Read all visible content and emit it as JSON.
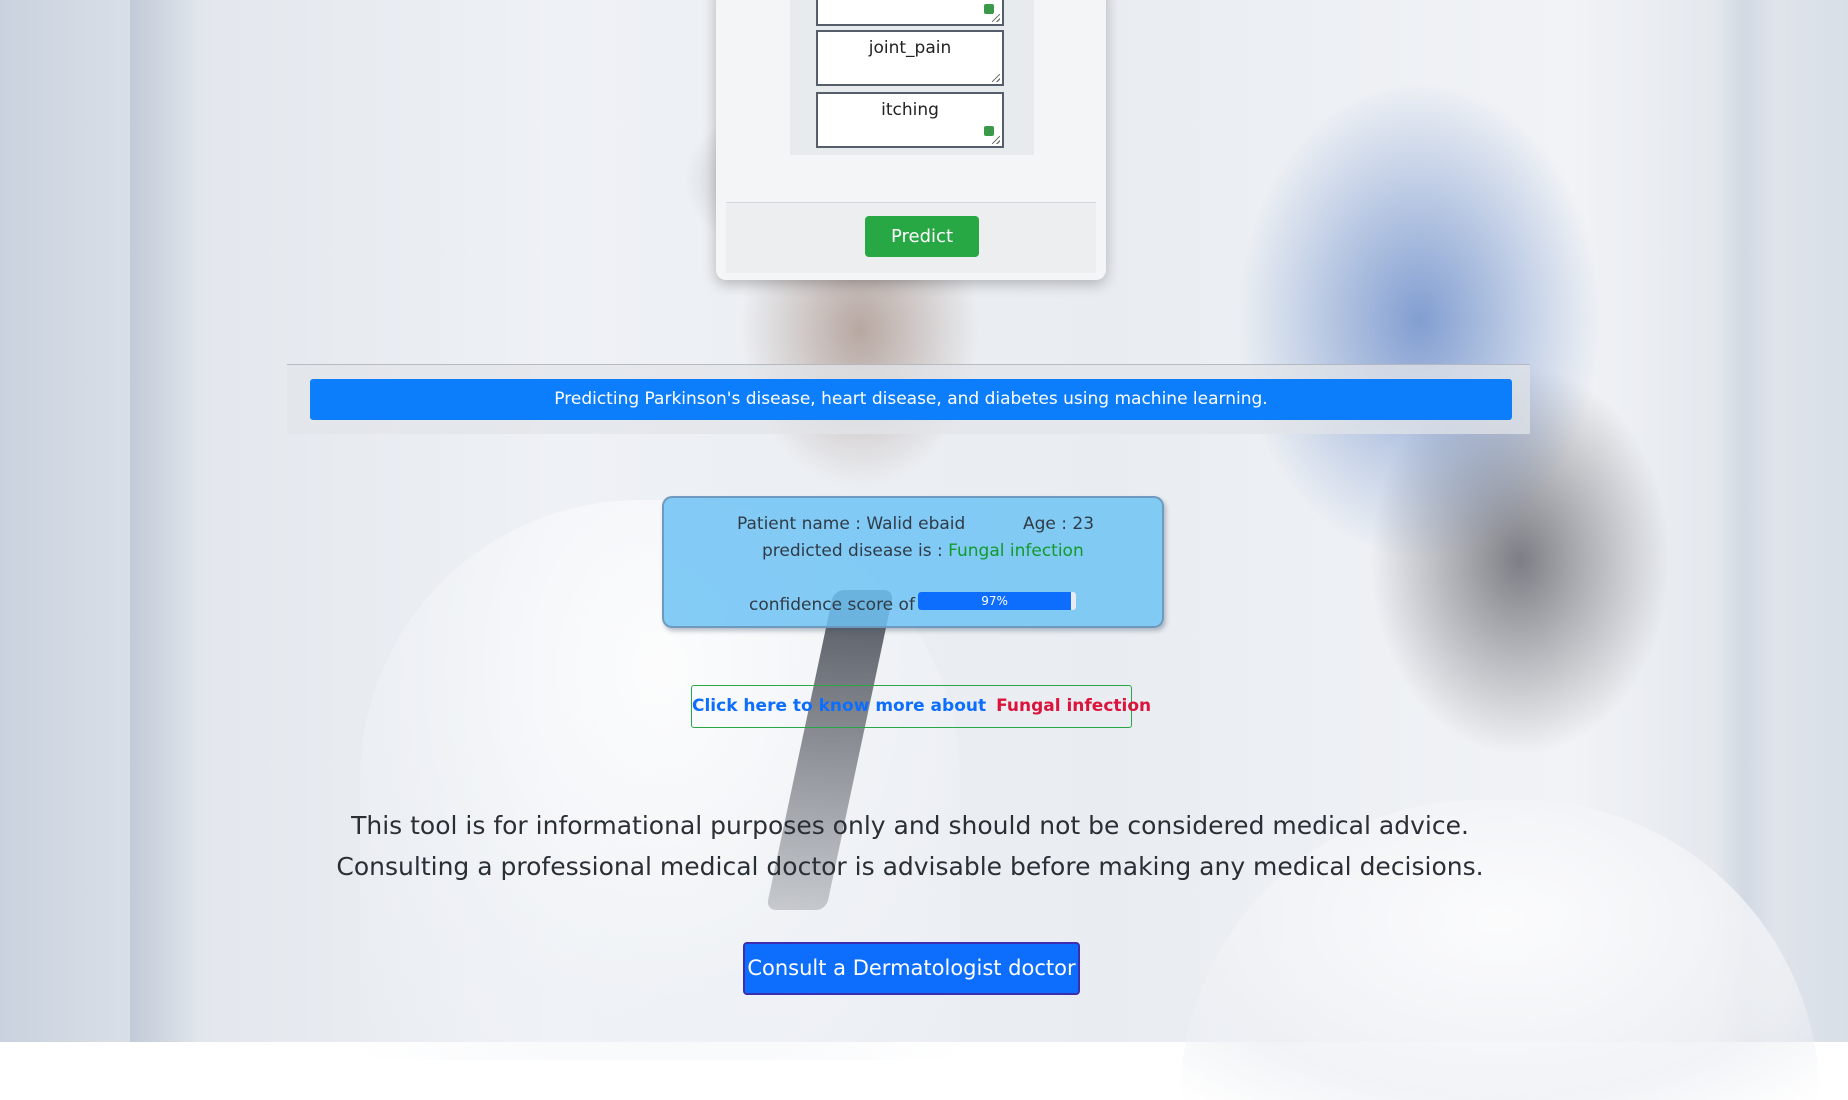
{
  "form": {
    "symptoms": [
      {
        "value": "",
        "has_grip": true
      },
      {
        "value": "joint_pain",
        "has_grip": false
      },
      {
        "value": "itching",
        "has_grip": true
      }
    ],
    "predict_label": "Predict"
  },
  "banner": {
    "text": "Predicting Parkinson's disease, heart disease, and diabetes using machine learning."
  },
  "result": {
    "patient_label": "Patient name : Walid ebaid",
    "age_label": "Age : 23",
    "predicted_prefix": "predicted disease is : ",
    "predicted_disease": "Fungal infection",
    "confidence_label": "confidence score of :",
    "confidence_percent": 97,
    "confidence_text": "97%"
  },
  "more_info": {
    "prefix": "Click here to know more about",
    "disease": "Fungal infection"
  },
  "disclaimer": {
    "line1": "This tool is for informational purposes only and should not be considered medical advice.",
    "line2": "Consulting a professional medical doctor is advisable before making any medical decisions."
  },
  "consult_button": {
    "label": "Consult a Dermatologist doctor"
  },
  "colors": {
    "primary": "#0d6efd",
    "success": "#28a745",
    "danger": "#dc143c",
    "result_card": "#6ec3f5"
  }
}
